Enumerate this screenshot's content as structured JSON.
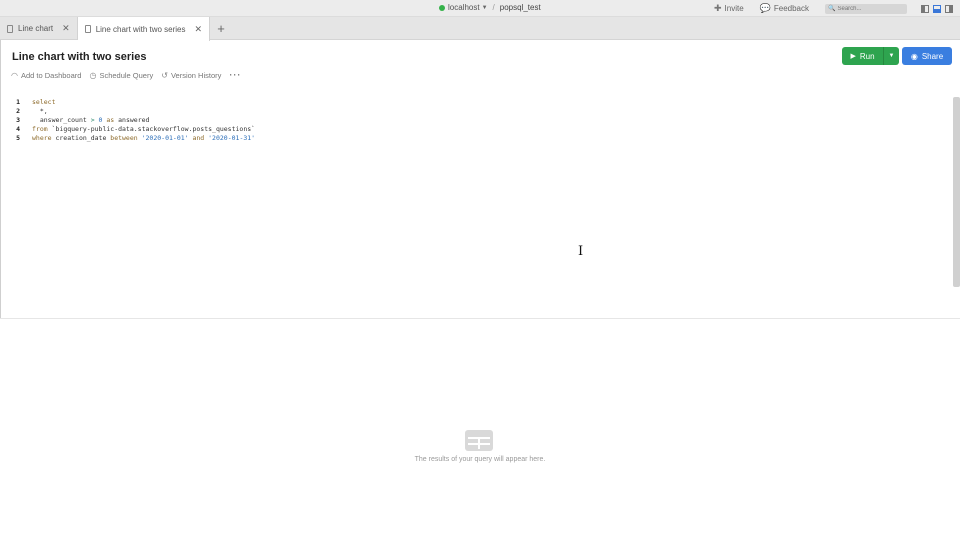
{
  "topbar": {
    "connection_name": "localhost",
    "connection_status_color": "#35b24a",
    "separator": "/",
    "database": "popsql_test",
    "invite_label": "Invite",
    "feedback_label": "Feedback",
    "search_placeholder": "Search..."
  },
  "tabs": [
    {
      "label": "Line chart"
    },
    {
      "label": "Line chart with two series"
    }
  ],
  "header": {
    "title": "Line chart with two series",
    "run_label": "Run",
    "share_label": "Share"
  },
  "actions": {
    "add_to_dashboard": "Add to Dashboard",
    "schedule_query": "Schedule Query",
    "version_history": "Version History",
    "more": "···"
  },
  "editor": {
    "line_numbers": [
      "1",
      "2",
      "3",
      "4",
      "5"
    ],
    "lines": [
      [
        "select"
      ],
      [
        "  *,"
      ],
      [
        "  answer_count",
        " > ",
        "0",
        " as ",
        "answered"
      ],
      [
        "from ",
        "`bigquery-public-data.stackoverflow.posts_questions`"
      ],
      [
        "where ",
        "creation_date ",
        "between ",
        "'2020-01-01'",
        " and ",
        "'2020-01-31'"
      ]
    ]
  },
  "results": {
    "empty_message": "The results of your query will appear here."
  },
  "colors": {
    "run": "#2ea44f",
    "share": "#3a7ee0",
    "keyword": "#8d6a2a",
    "string": "#2a6db8"
  }
}
